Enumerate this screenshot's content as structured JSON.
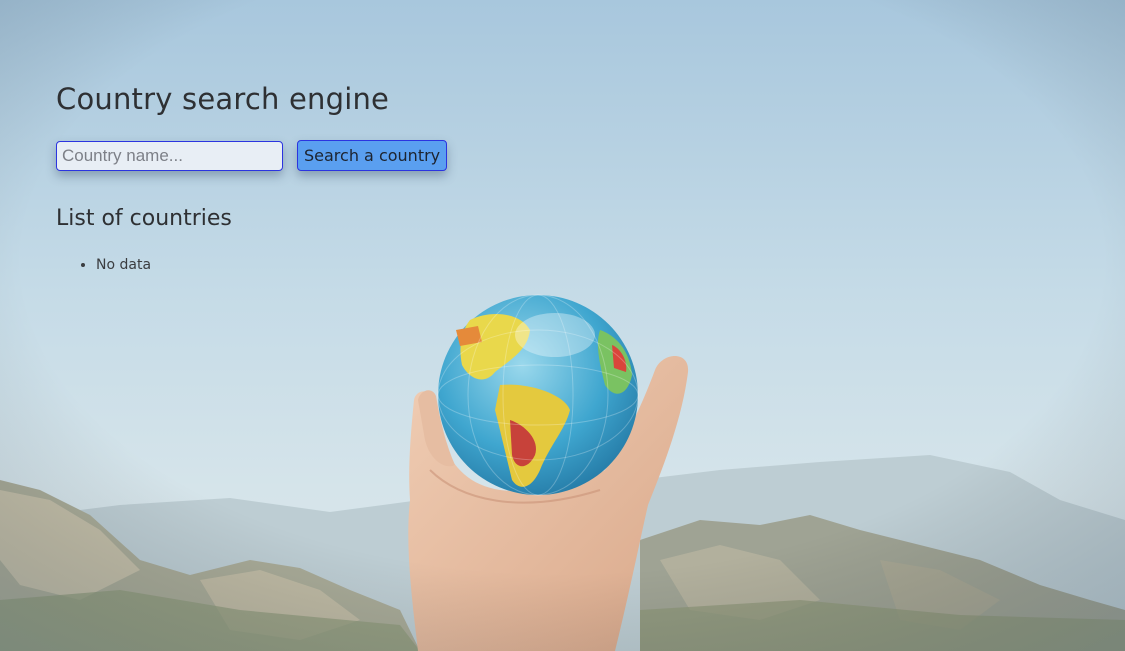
{
  "page": {
    "title": "Country search engine"
  },
  "search": {
    "placeholder": "Country name...",
    "value": "",
    "button_label": "Search a country"
  },
  "list": {
    "title": "List of countries",
    "items": [
      {
        "label": "No data"
      }
    ]
  },
  "colors": {
    "accent_border": "#2b34e0",
    "button_bg": "#5a9ff0",
    "text": "#2e3033"
  }
}
